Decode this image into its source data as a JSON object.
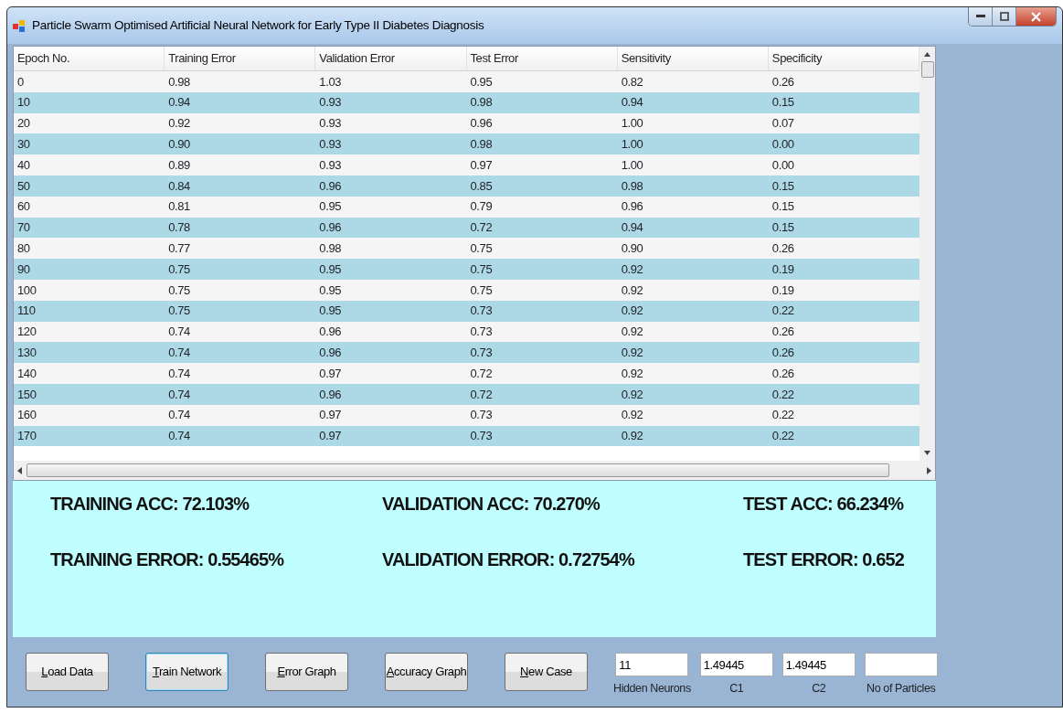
{
  "window": {
    "title": "Particle Swarm Optimised Artificial Neural Network for Early Type II Diabetes Diagnosis"
  },
  "table": {
    "columns": [
      "Epoch No.",
      "Training Error",
      "Validation Error",
      "Test Error",
      "Sensitivity",
      "Specificity"
    ],
    "rows": [
      [
        "0",
        "0.98",
        "1.03",
        "0.95",
        "0.82",
        "0.26"
      ],
      [
        "10",
        "0.94",
        "0.93",
        "0.98",
        "0.94",
        "0.15"
      ],
      [
        "20",
        "0.92",
        "0.93",
        "0.96",
        "1.00",
        "0.07"
      ],
      [
        "30",
        "0.90",
        "0.93",
        "0.98",
        "1.00",
        "0.00"
      ],
      [
        "40",
        "0.89",
        "0.93",
        "0.97",
        "1.00",
        "0.00"
      ],
      [
        "50",
        "0.84",
        "0.96",
        "0.85",
        "0.98",
        "0.15"
      ],
      [
        "60",
        "0.81",
        "0.95",
        "0.79",
        "0.96",
        "0.15"
      ],
      [
        "70",
        "0.78",
        "0.96",
        "0.72",
        "0.94",
        "0.15"
      ],
      [
        "80",
        "0.77",
        "0.98",
        "0.75",
        "0.90",
        "0.26"
      ],
      [
        "90",
        "0.75",
        "0.95",
        "0.75",
        "0.92",
        "0.19"
      ],
      [
        "100",
        "0.75",
        "0.95",
        "0.75",
        "0.92",
        "0.19"
      ],
      [
        "110",
        "0.75",
        "0.95",
        "0.73",
        "0.92",
        "0.22"
      ],
      [
        "120",
        "0.74",
        "0.96",
        "0.73",
        "0.92",
        "0.26"
      ],
      [
        "130",
        "0.74",
        "0.96",
        "0.73",
        "0.92",
        "0.26"
      ],
      [
        "140",
        "0.74",
        "0.97",
        "0.72",
        "0.92",
        "0.26"
      ],
      [
        "150",
        "0.74",
        "0.96",
        "0.72",
        "0.92",
        "0.22"
      ],
      [
        "160",
        "0.74",
        "0.97",
        "0.73",
        "0.92",
        "0.22"
      ],
      [
        "170",
        "0.74",
        "0.97",
        "0.73",
        "0.92",
        "0.22"
      ]
    ]
  },
  "stats": [
    [
      "TRAINING ACC: 72.103%",
      "VALIDATION ACC: 70.270%",
      "TEST ACC: 66.234%"
    ],
    [
      "TRAINING ERROR: 0.55465%",
      "VALIDATION ERROR: 0.72754%",
      "TEST ERROR: 0.652"
    ]
  ],
  "buttons": [
    {
      "label": "Load Data",
      "focused": false
    },
    {
      "label": "Train Network",
      "focused": true
    },
    {
      "label": "Error Graph",
      "focused": false
    },
    {
      "label": "Accuracy Graph",
      "focused": false
    },
    {
      "label": "New Case",
      "focused": false
    }
  ],
  "fields": [
    {
      "value": "11",
      "label": "Hidden Neurons"
    },
    {
      "value": "1.49445",
      "label": "C1"
    },
    {
      "value": "1.49445",
      "label": "C2"
    },
    {
      "label": "No of Particles"
    }
  ]
}
